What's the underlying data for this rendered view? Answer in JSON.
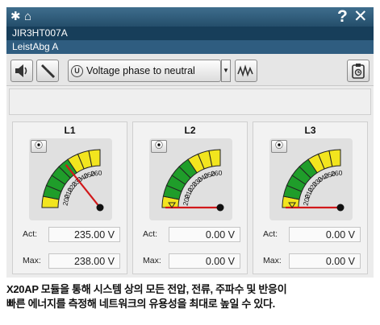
{
  "titlebar": {
    "pin_icon": "pin-icon",
    "home_icon": "home-icon",
    "help_label": "?",
    "close_label": "✕"
  },
  "device_id": "JIR3HT007A",
  "module_name": "LeistAbg A",
  "toolbar": {
    "dropdown_value": "Voltage phase to neutral",
    "u_icon_label": "U",
    "icons": [
      "speaker-icon",
      "tools-icon",
      "waveform-icon",
      "clipboard-icon"
    ]
  },
  "scale_labels": [
    "200",
    "210",
    "220",
    "230",
    "240",
    "250",
    "260"
  ],
  "colors": {
    "title_bar": "#2e5c7d",
    "gauge_green": "#1f9d2a",
    "gauge_yellow": "#f2e51e",
    "needle": "#d1191b"
  },
  "phases": [
    {
      "name": "L1",
      "act_label": "Act:",
      "act": "235.00 V",
      "max_label": "Max:",
      "max": "238.00 V"
    },
    {
      "name": "L2",
      "act_label": "Act:",
      "act": "0.00 V",
      "max_label": "Max:",
      "max": "0.00 V"
    },
    {
      "name": "L3",
      "act_label": "Act:",
      "act": "0.00 V",
      "max_label": "Max:",
      "max": "0.00 V"
    }
  ],
  "caption_line1": "X20AP 모듈을 통해 시스템 상의 모든 전압, 전류, 주파수 및 반응이",
  "caption_line2": "빠른 에너지를 측정해 네트워크의 유용성을 최대로 높일 수 있다."
}
